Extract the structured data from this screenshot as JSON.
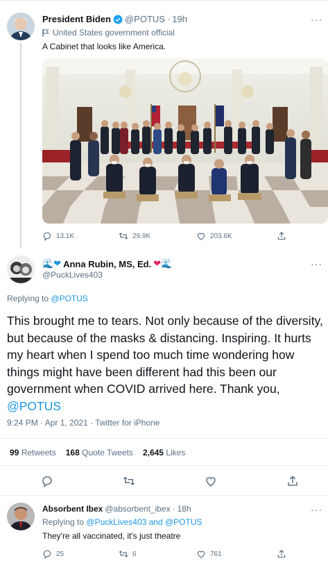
{
  "tweet1": {
    "author_name": "President Biden",
    "handle": "@POTUS",
    "time": "19h",
    "label": "United States government official",
    "text": "A Cabinet that looks like America.",
    "replies": "13.1K",
    "retweets": "29.9K",
    "likes": "203.6K"
  },
  "main_tweet": {
    "author_name": "Anna Rubin, MS, Ed.",
    "emoji_prefix": "🌊❤",
    "emoji_suffix": "❤🌊",
    "handle": "@PuckLives403",
    "replying_prefix": "Replying to",
    "replying_to": "@POTUS",
    "text": "This brought me to tears.  Not only because of the diversity, but because of the masks & distancing. Inspiring.  It hurts my heart when I spend too much time wondering how things might have been different had this been our government when COVID arrived here.  Thank you,",
    "text_mention": "@POTUS",
    "meta": "9:24 PM · Apr 1, 2021 · Twitter for iPhone",
    "retweets_count": "99",
    "retweets_label": "Retweets",
    "quote_count": "168",
    "quote_label": "Quote Tweets",
    "likes_count": "2,645",
    "likes_label": "Likes"
  },
  "reply_tweet": {
    "author_name": "Absorbent Ibex",
    "handle": "@absorbent_ibex",
    "time": "18h",
    "replying_prefix": "Replying to",
    "replying_to": "@PuckLives403 and @POTUS",
    "text": "They're all vaccinated, it's just theatre",
    "replies": "25",
    "retweets": "6",
    "likes": "761"
  },
  "colors": {
    "accent": "#1b95e0",
    "secondary_text": "#5b7083",
    "divider": "#e6ecf0"
  },
  "icons": [
    "verified-badge-icon",
    "government-flag-icon",
    "reply-icon",
    "retweet-icon",
    "like-icon",
    "share-icon",
    "more-icon"
  ]
}
